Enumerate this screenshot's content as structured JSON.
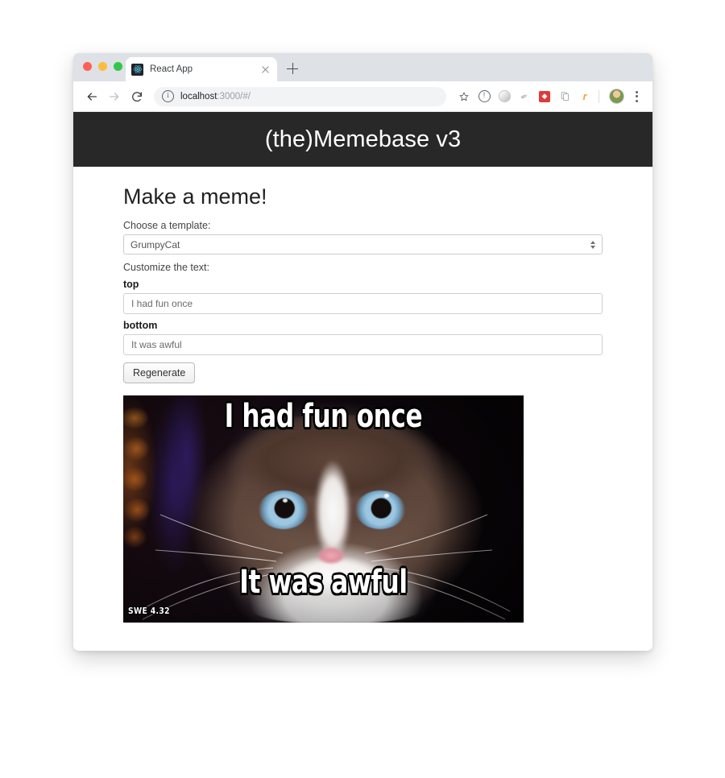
{
  "browser": {
    "tab": {
      "title": "React App",
      "favicon_icon": "react-logo-icon",
      "close_icon": "close-icon"
    },
    "new_tab_icon": "plus-icon",
    "traffic_lights": [
      "close",
      "minimize",
      "maximize"
    ],
    "nav": {
      "back_icon": "arrow-left-icon",
      "forward_icon": "arrow-right-icon",
      "reload_icon": "reload-icon"
    },
    "omnibox": {
      "site_info_icon": "info-circle-icon",
      "url_host": "localhost",
      "url_rest": ":3000/#/"
    },
    "actions": [
      {
        "name": "bookmark-star-icon",
        "glyph": "☆"
      },
      {
        "name": "extension-info-icon",
        "glyph": ""
      },
      {
        "name": "extension-sphere-icon",
        "glyph": ""
      },
      {
        "name": "extension-brush-icon",
        "glyph": "✎"
      },
      {
        "name": "extension-red-icon",
        "glyph": "◆"
      },
      {
        "name": "extension-document-icon",
        "glyph": "❐"
      },
      {
        "name": "extension-orange-icon",
        "glyph": "r"
      }
    ],
    "avatar_icon": "profile-avatar",
    "menu_icon": "kebab-menu-icon"
  },
  "app": {
    "header_title": "(the)Memebase v3",
    "heading": "Make a meme!",
    "template_label": "Choose a template:",
    "template_selected": "GrumpyCat",
    "select_arrow_icon": "updown-arrows-icon",
    "customize_label": "Customize the text:",
    "fields": [
      {
        "label": "top",
        "value": "I had fun once"
      },
      {
        "label": "bottom",
        "value": "It was awful"
      }
    ],
    "regenerate_label": "Regenerate"
  },
  "meme": {
    "top_text": "I had fun once",
    "bottom_text": "It was awful",
    "watermark": "SWE 4.32",
    "alt": "Grumpy Cat meme template"
  },
  "colors": {
    "header_bg": "#282828",
    "page_bg": "#ffffff",
    "tabstrip_bg": "#dee1e6",
    "meme_text": "#ffffff"
  }
}
